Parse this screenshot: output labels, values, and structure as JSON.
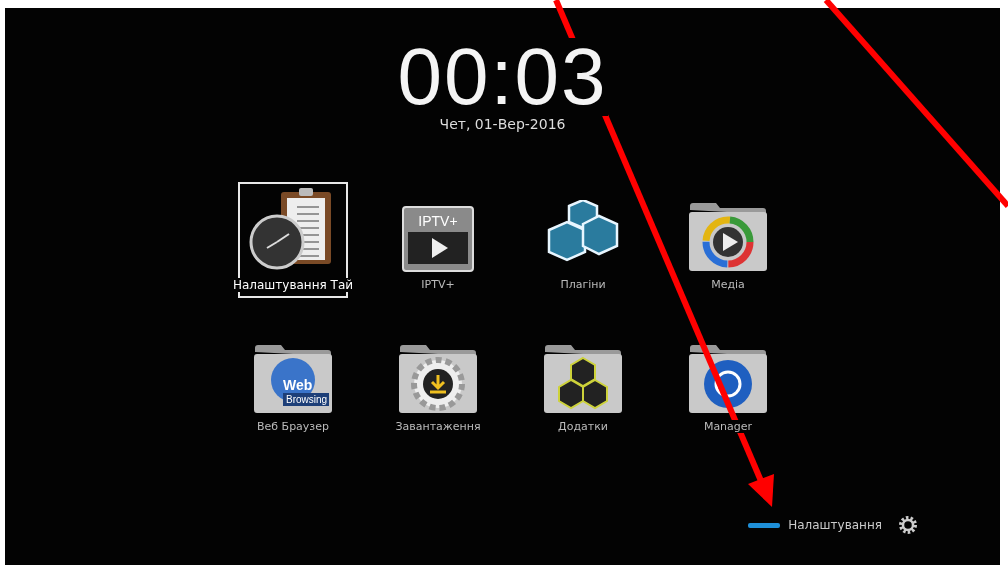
{
  "clock": {
    "time": "00:03",
    "date": "Чет, 01-Вер-2016"
  },
  "tiles": [
    {
      "label": "Налаштування Тай",
      "kind": "clock",
      "selected": true
    },
    {
      "label": "IPTV+",
      "kind": "iptv",
      "selected": false,
      "icon_text": "IPTV+"
    },
    {
      "label": "Плагіни",
      "kind": "cubes",
      "selected": false
    },
    {
      "label": "Медіа",
      "kind": "media",
      "selected": false
    },
    {
      "label": "Веб Браузер",
      "kind": "web",
      "selected": false,
      "icon_text": "Web",
      "icon_subtext": "Browsing"
    },
    {
      "label": "Завантаження",
      "kind": "download",
      "selected": false
    },
    {
      "label": "Додатки",
      "kind": "addons",
      "selected": false
    },
    {
      "label": "Manager",
      "kind": "manager",
      "selected": false
    }
  ],
  "footer": {
    "label": "Налаштування",
    "color": "#1e8fd8"
  }
}
